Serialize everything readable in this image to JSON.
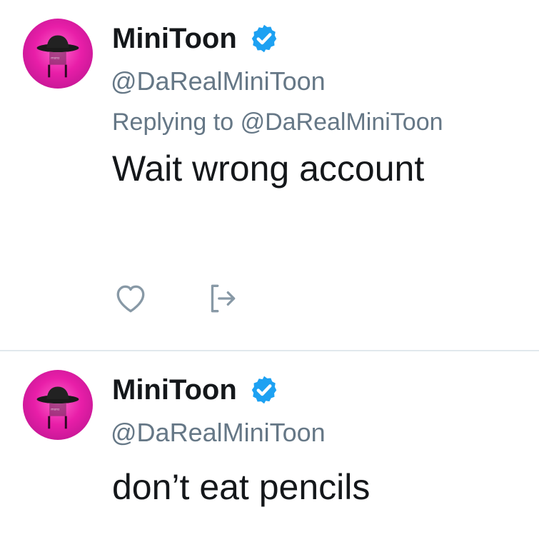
{
  "tweets": [
    {
      "display_name": "MiniToon",
      "handle": "@DaRealMiniToon",
      "replying_label": "Replying to",
      "replying_to": "@DaRealMiniToon",
      "text": "Wait wrong account",
      "actions": [
        "heart-icon",
        "share-icon"
      ]
    },
    {
      "display_name": "MiniToon",
      "handle": "@DaRealMiniToon",
      "text": "don’t eat pencils"
    }
  ],
  "colors": {
    "verified": "#1da1f2",
    "secondary_text": "#657786",
    "primary_text": "#14171a",
    "divider": "#e1e8ed",
    "avatar": "#e81ea8"
  }
}
